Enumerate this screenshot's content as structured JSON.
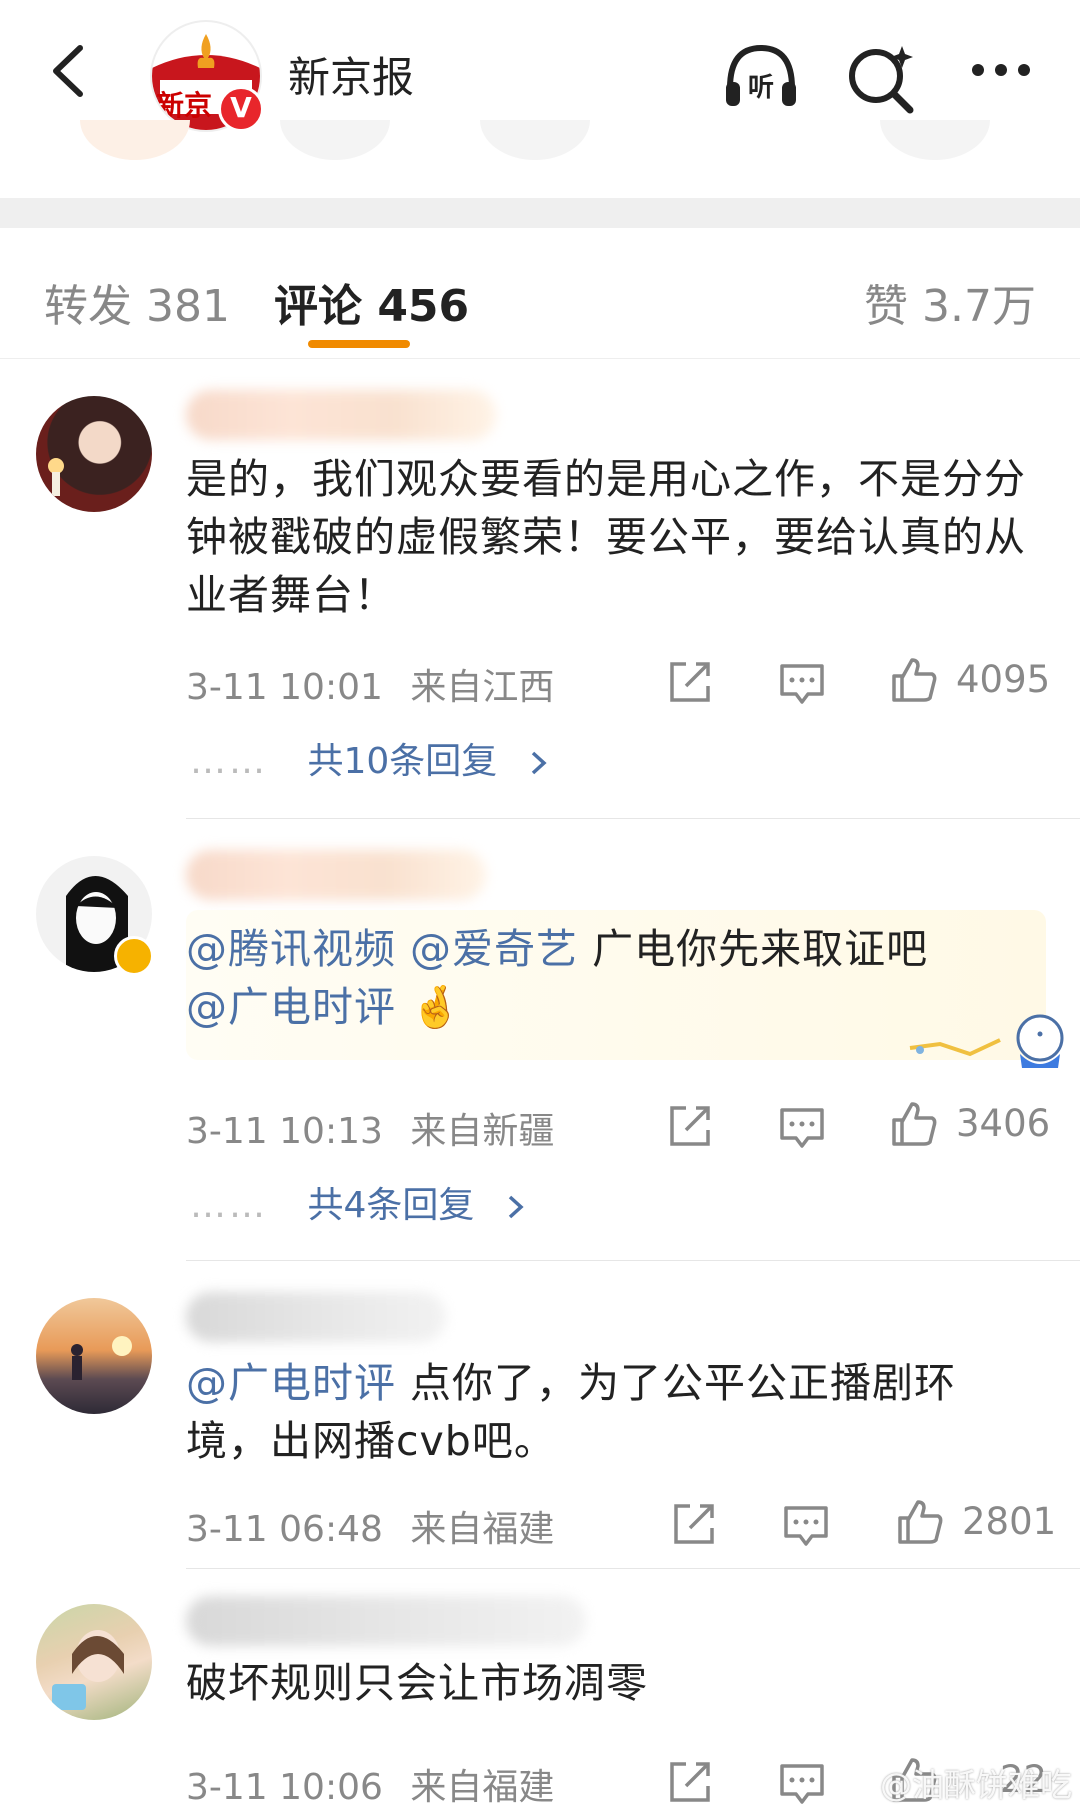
{
  "header": {
    "title": "新京报",
    "logo_text": "新京",
    "verified_badge": "V"
  },
  "tabs": {
    "repost": "转发 381",
    "comments": "评论 456",
    "likes": "赞 3.7万"
  },
  "comments": [
    {
      "text": "是的，我们观众要看的是用心之作，不是分分钟被戳破的虚假繁荣！要公平，要给认真的从业者舞台！",
      "time": "3-11 10:01",
      "location": "来自江西",
      "likes": "4095",
      "replies": "共10条回复"
    },
    {
      "mention1": "@腾讯视频",
      "mention2": "@爱奇艺",
      "text": " 广电你先来取证吧",
      "mention3": "@广电时评",
      "emoji": "🤞",
      "time": "3-11 10:13",
      "location": "来自新疆",
      "likes": "3406",
      "replies": "共4条回复"
    },
    {
      "mention": "@广电时评",
      "text": "  点你了，为了公平公正播剧环境，出网播cvb吧。",
      "time": "3-11 06:48",
      "location": "来自福建",
      "likes": "2801"
    },
    {
      "text": "破坏规则只会让市场凋零",
      "time": "3-11 10:06",
      "location": "来自福建",
      "likes": "22"
    }
  ],
  "reply_dots": "……",
  "watermark": "@油酥饼难吃",
  "icons": [
    "back-icon",
    "listen-icon",
    "search-icon",
    "more-icon",
    "share-icon",
    "comment-icon",
    "like-icon",
    "chevron-right-icon"
  ]
}
